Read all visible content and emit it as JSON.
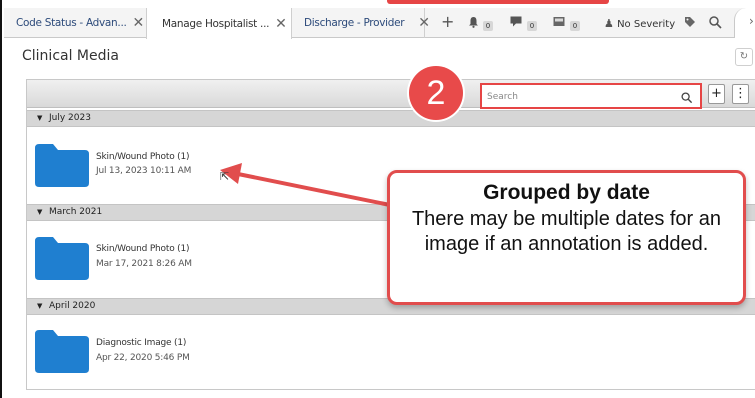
{
  "tabs": [
    {
      "label": "Code Status - Advan...",
      "active": false
    },
    {
      "label": "Manage Hospitalist ...",
      "active": true
    },
    {
      "label": "Discharge - Provider",
      "active": false
    }
  ],
  "toolbar_icons": {
    "add": "plus-icon",
    "notifications": {
      "icon": "bell-icon",
      "count": "0"
    },
    "messages": {
      "icon": "message-icon",
      "count": "0"
    },
    "inbox": {
      "icon": "inbox-icon",
      "count": "0"
    },
    "severity": {
      "icon": "person-icon",
      "label": "No Severity"
    },
    "tag": "tag-icon",
    "search": "search-icon"
  },
  "page": {
    "title": "Clinical Media"
  },
  "search": {
    "placeholder": "Search"
  },
  "groups": [
    {
      "label": "July 2023",
      "items": [
        {
          "name": "Skin/Wound Photo (1)",
          "date": "Jul 13, 2023 10:11 AM"
        }
      ]
    },
    {
      "label": "March 2021",
      "items": [
        {
          "name": "Skin/Wound Photo (1)",
          "date": "Mar 17, 2021 8:26 AM"
        }
      ]
    },
    {
      "label": "April 2020",
      "items": [
        {
          "name": "Diagnostic Image (1)",
          "date": "Apr 22, 2020 5:46 PM"
        }
      ]
    }
  ],
  "annotation": {
    "step": "2",
    "heading": "Grouped by date",
    "body": "There may be multiple dates for an image if an annotation is added."
  },
  "colors": {
    "folder": "#1f7fd0",
    "callout_border": "#e14d4d",
    "badge": "#e84a4a"
  }
}
